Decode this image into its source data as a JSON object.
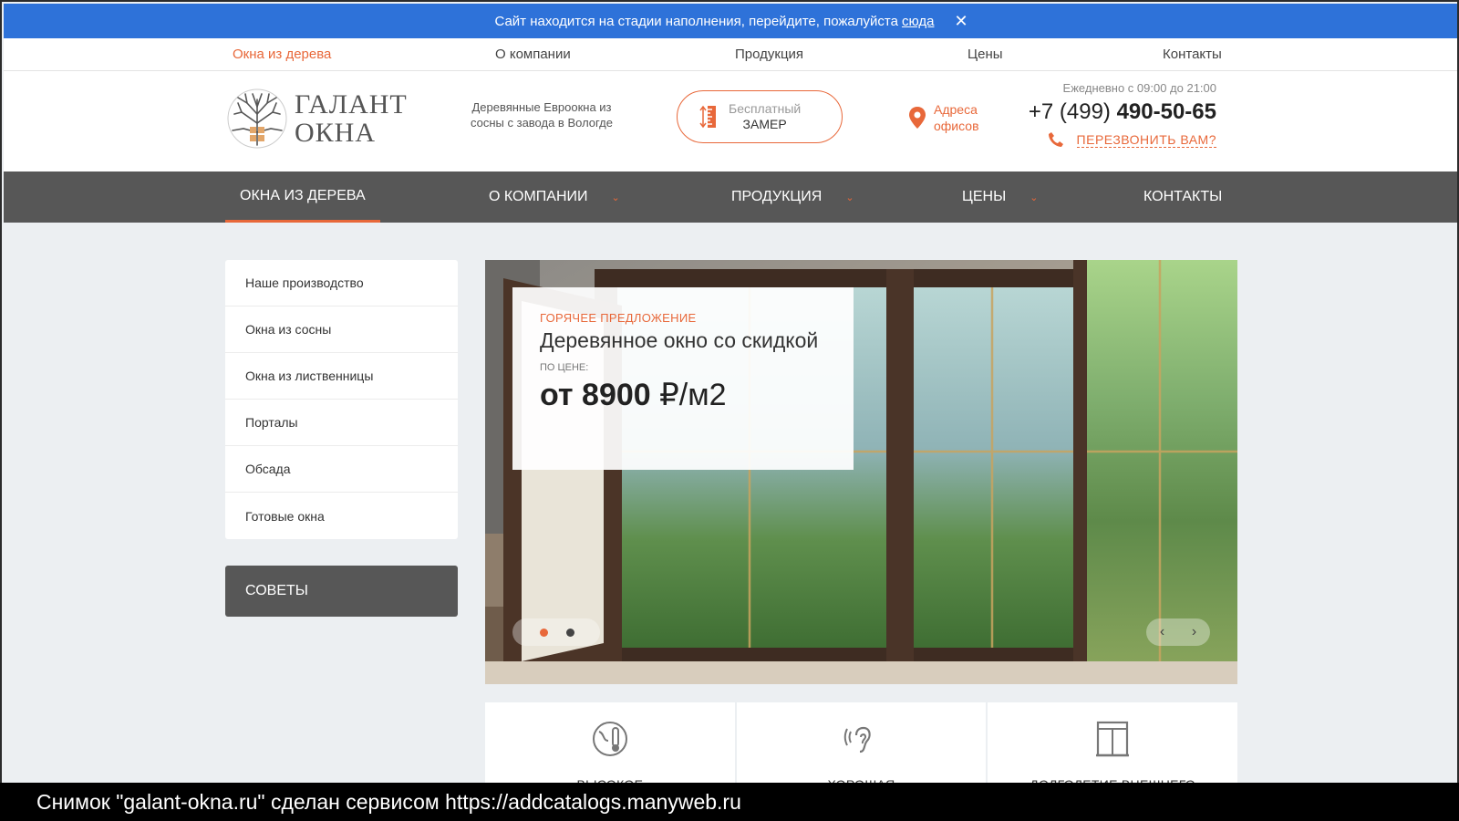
{
  "notice": {
    "text": "Сайт находится на стадии наполнения, перейдите, пожалуйста",
    "link": "сюда",
    "close_icon": "close-icon"
  },
  "topnav": [
    "Окна из дерева",
    "О компании",
    "Продукция",
    "Цены",
    "Контакты"
  ],
  "header": {
    "logo_line1": "ГАЛАНТ",
    "logo_line2": "ОКНА",
    "tagline": "Деревянные Евроокна из сосны с завода в Вологде",
    "zamer_line1": "Бесплатный",
    "zamer_line2": "ЗАМЕР",
    "addr_line1": "Адреса",
    "addr_line2": "офисов",
    "hours": "Ежедневно с 09:00 до 21:00",
    "phone_prefix": "+7 (499)",
    "phone_number": "490-50-65",
    "callback": "ПЕРЕЗВОНИТЬ ВАМ?"
  },
  "mainnav": [
    "ОКНА ИЗ ДЕРЕВА",
    "О КОМПАНИИ",
    "ПРОДУКЦИЯ",
    "ЦЕНЫ",
    "КОНТАКТЫ"
  ],
  "sidebar": {
    "items": [
      "Наше производство",
      "Окна из сосны",
      "Окна из лиственницы",
      "Порталы",
      "Обсада",
      "Готовые окна"
    ],
    "tips": "СОВЕТЫ"
  },
  "slider": {
    "hot": "ГОРЯЧЕЕ ПРЕДЛОЖЕНИЕ",
    "title": "Деревянное окно со скидкой",
    "label": "ПО ЦЕНЕ:",
    "price_from": "от",
    "price_value": "8900",
    "price_unit": "₽/м2",
    "slides_total": 2,
    "active_slide": 1
  },
  "features": [
    "ВЫСОКОЕ",
    "ХОРОШАЯ",
    "ДОЛГОЛЕТИЕ ВНЕШНЕГО"
  ],
  "caption": "Снимок \"galant-okna.ru\" сделан сервисом https://addcatalogs.manyweb.ru",
  "colors": {
    "accent": "#e8683a",
    "notice": "#2e72d9",
    "nav": "#575757"
  }
}
